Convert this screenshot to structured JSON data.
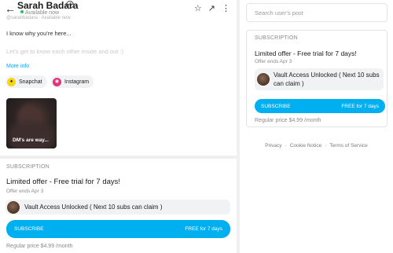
{
  "header": {
    "back_icon": "arrow-left-icon",
    "name": "Sarah Badara",
    "status": "Available now",
    "cut_text": "@sarahbadara · Available now",
    "icons": [
      "star-icon",
      "share-icon",
      "more-vertical-icon"
    ]
  },
  "bio": {
    "line1": "I know why you're here...",
    "line2": "Let's get to know each other inside and out :)",
    "more": "More info"
  },
  "socials": [
    {
      "label": "Snapchat",
      "icon": "snapchat-icon"
    },
    {
      "label": "Instagram",
      "icon": "instagram-icon"
    }
  ],
  "media": {
    "caption": "DM's are way..."
  },
  "subscription": {
    "heading": "SUBSCRIPTION",
    "offer_title": "Limited offer - Free trial for 7 days!",
    "offer_ends": "Offer ends Apr 3",
    "message": "Vault Access Unlocked ( Next 10 subs can claim )",
    "button_left": "SUBSCRIBE",
    "button_right": "FREE for 7 days",
    "price": "Regular price $4.99 /month"
  },
  "sidebar": {
    "search_placeholder": "Search user's post",
    "footer": [
      "Privacy",
      "Cookie Notice",
      "Terms of Service"
    ],
    "footer_sep": "·"
  },
  "colors": {
    "accent": "#00aff0",
    "online": "#27c06a",
    "link": "#1a9ee3"
  }
}
